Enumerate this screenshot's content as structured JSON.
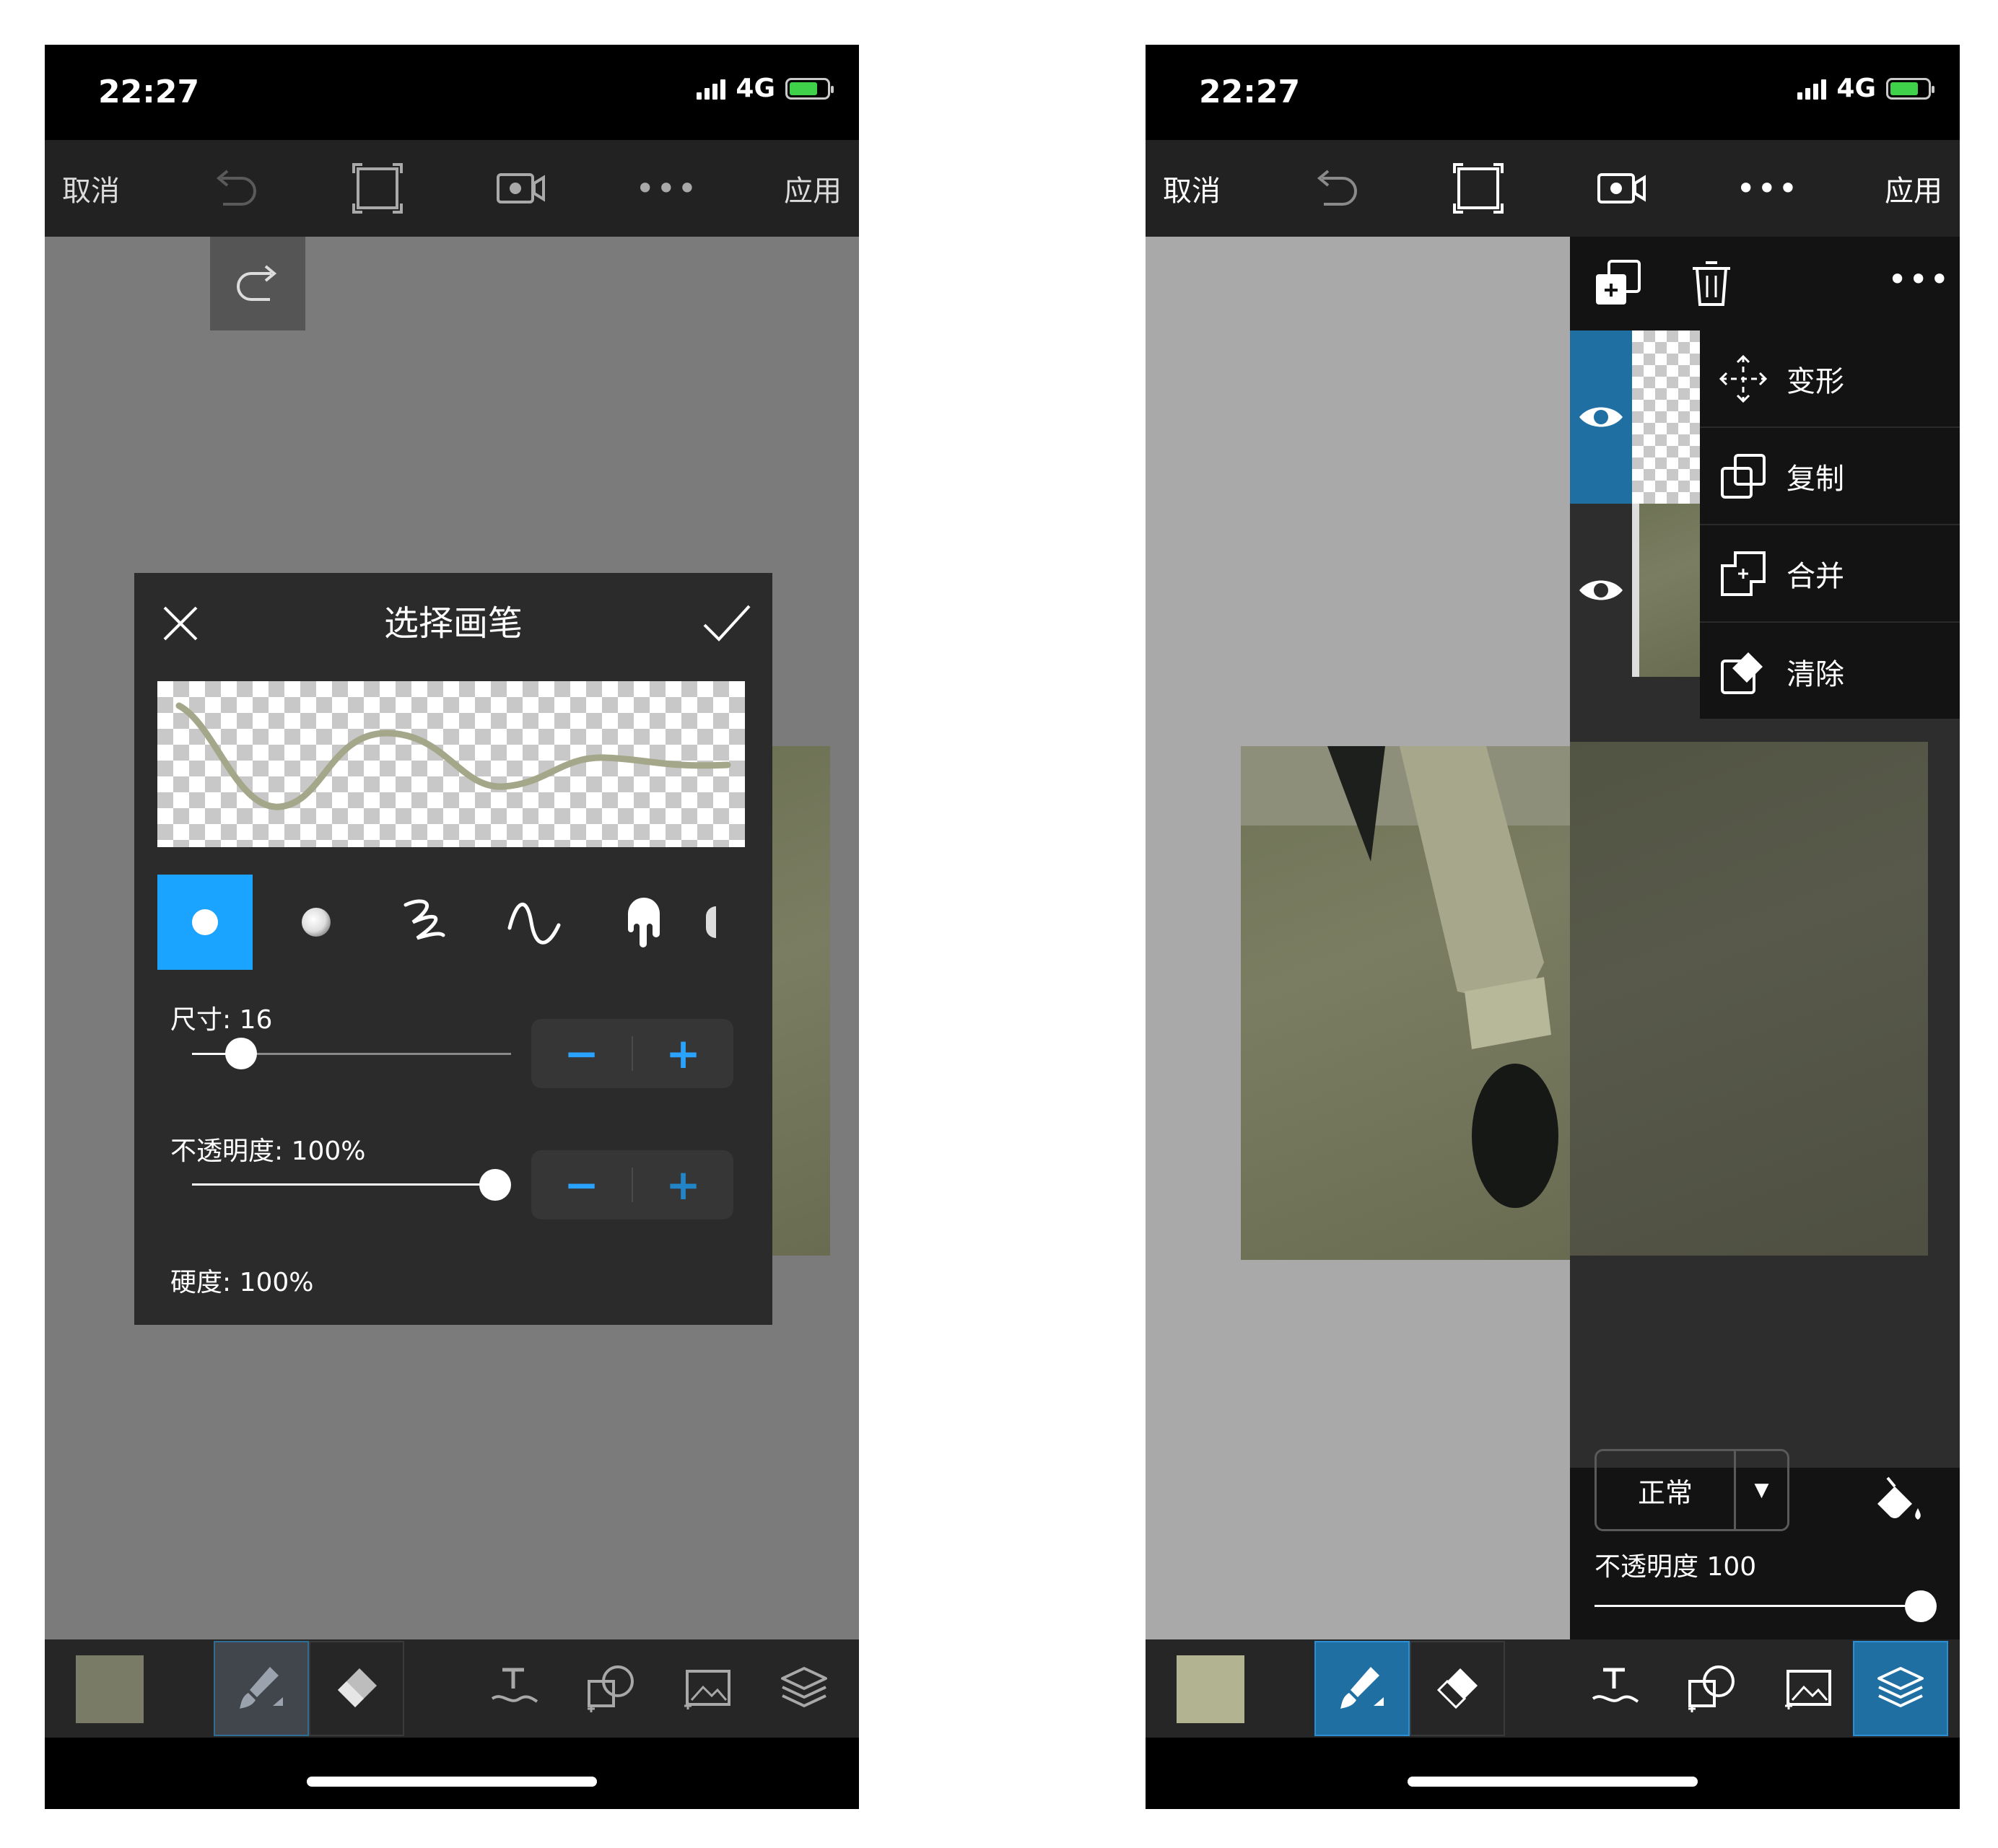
{
  "status": {
    "time": "22:27",
    "network": "4G"
  },
  "toolbar": {
    "cancel": "取消",
    "apply": "应用",
    "more": "•••"
  },
  "colors": {
    "brush_accent": "#1aa3ff",
    "selected_tool": "#1f6fa3",
    "left_swatch": "#7a7b67",
    "right_swatch": "#b2b391",
    "stroke": "#a5a78a"
  },
  "brush_dialog": {
    "title": "选择画笔",
    "size_label": "尺寸: 16",
    "opacity_label": "不透明度: 100%",
    "hardness_label": "硬度: 100%",
    "size_value": 16,
    "opacity_value": 100,
    "hardness_value": 100,
    "minus": "−",
    "plus": "+"
  },
  "layer_menu": {
    "items": [
      {
        "label": "变形",
        "icon": "move-arrows-icon"
      },
      {
        "label": "复制",
        "icon": "duplicate-icon"
      },
      {
        "label": "合并",
        "icon": "merge-icon"
      },
      {
        "label": "清除",
        "icon": "eraser-clear-icon"
      }
    ]
  },
  "layer_props": {
    "blend_mode": "正常",
    "blend_arrow": "▼",
    "opacity_label": "不透明度 100",
    "opacity_value": 100
  }
}
